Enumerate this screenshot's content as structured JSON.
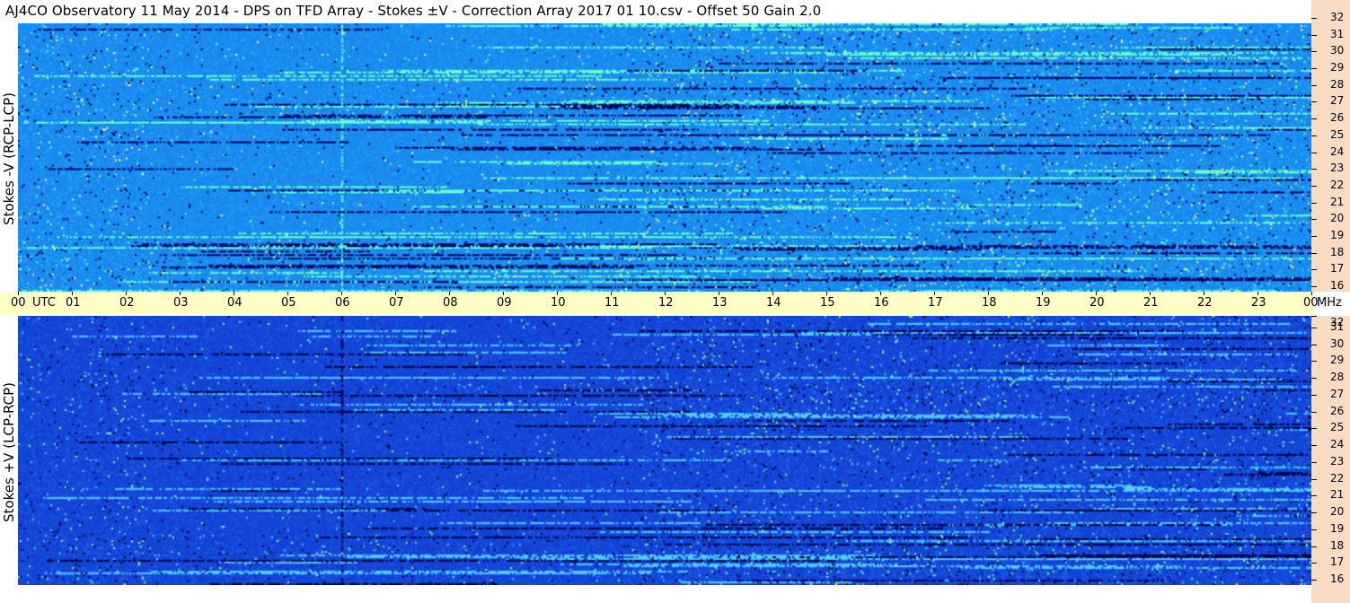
{
  "header": {
    "title": "AJ4CO Observatory  11 May 2014  -  DPS on TFD Array  -  Stokes ±V  -  Correction Array 2017 01 10.csv  -  Offset 50  Gain 2.0"
  },
  "chart_data": [
    {
      "type": "heatmap",
      "name": "Stokes -V (RCP-LCP)",
      "ylabel": "Stokes -V (RCP-LCP)",
      "xlabel": "UTC",
      "x_ticks": [
        "00",
        "01",
        "02",
        "03",
        "04",
        "05",
        "06",
        "07",
        "08",
        "09",
        "10",
        "11",
        "12",
        "13",
        "14",
        "15",
        "16",
        "17",
        "18",
        "19",
        "20",
        "21",
        "22",
        "23",
        "00"
      ],
      "y_unit": "MHz",
      "y_ticks": [
        "16",
        "17",
        "18",
        "19",
        "20",
        "21",
        "22",
        "23",
        "24",
        "25",
        "26",
        "27",
        "28",
        "29",
        "30",
        "31",
        "32"
      ],
      "xlim_hours": [
        0,
        24
      ],
      "ylim_mhz": [
        16,
        32
      ],
      "colormap": [
        "#000060",
        "#0033cc",
        "#1a8cff",
        "#33ccff",
        "#66ffcc",
        "#ffff66"
      ],
      "base_color": "#1a8cf0"
    },
    {
      "type": "heatmap",
      "name": "Stokes +V (LCP-RCP)",
      "ylabel": "Stokes +V (LCP-RCP)",
      "xlabel": "UTC",
      "x_ticks": [
        "00",
        "01",
        "02",
        "03",
        "04",
        "05",
        "06",
        "07",
        "08",
        "09",
        "10",
        "11",
        "12",
        "13",
        "14",
        "15",
        "16",
        "17",
        "18",
        "19",
        "20",
        "21",
        "22",
        "23",
        "00"
      ],
      "y_unit": "MHz",
      "y_ticks": [
        "16",
        "17",
        "18",
        "19",
        "20",
        "21",
        "22",
        "23",
        "24",
        "25",
        "26",
        "27",
        "28",
        "29",
        "30",
        "31",
        "32"
      ],
      "xlim_hours": [
        0,
        24
      ],
      "ylim_mhz": [
        16,
        32
      ],
      "colormap": [
        "#000040",
        "#0a1f99",
        "#1446dc",
        "#2a7fff",
        "#4fd0ff",
        "#a0ff80"
      ],
      "base_color": "#1446d8"
    }
  ],
  "time_axis": {
    "utc_label": "UTC",
    "mhz_label": "MHz",
    "background": "#ffffc6"
  },
  "freq_axis_background": "#f9dcc3"
}
